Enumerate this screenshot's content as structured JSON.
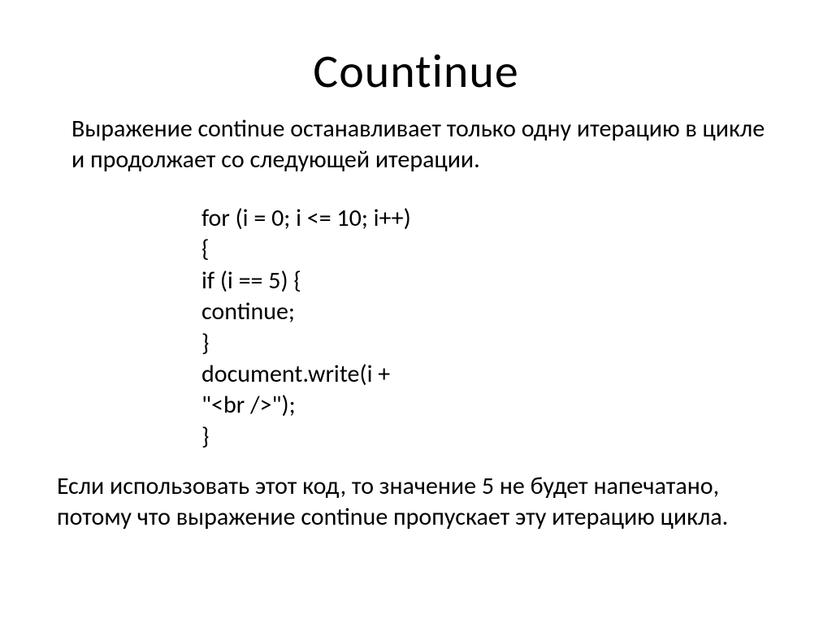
{
  "title": "Countinue",
  "intro": "Выражение continue останавливает только одну итерацию в цикле и продолжает со следующей итерации.",
  "code": "for (i = 0; i <= 10; i++)\n{\nif (i == 5) {\ncontinue;\n}\ndocument.write(i +\n\"<br />\");\n}",
  "outro": "Если использовать этот код,  то значение 5 не будет напечатано, потому что выражение continue пропускает эту итерацию цикла."
}
